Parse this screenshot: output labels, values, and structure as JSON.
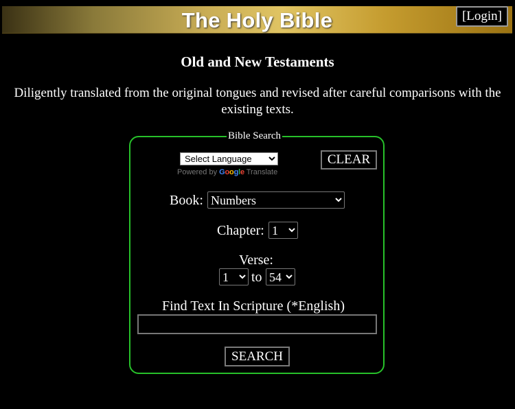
{
  "header": {
    "title": "The Holy Bible",
    "login_label": "[Login]"
  },
  "subtitle": "Old and New Testaments",
  "description": "Diligently translated from the original tongues and revised after careful comparisons with the existing texts.",
  "search": {
    "legend": "Bible Search",
    "language_select": "Select Language",
    "powered_by": "Powered by",
    "google": "Google",
    "translate": "Translate",
    "clear_label": "CLEAR",
    "book_label": "Book:",
    "book_value": "Numbers",
    "chapter_label": "Chapter:",
    "chapter_value": "1",
    "verse_label": "Verse:",
    "verse_from": "1",
    "verse_to_label": "to",
    "verse_to": "54",
    "find_label": "Find Text In Scripture (*English)",
    "search_text": "",
    "search_label": "SEARCH"
  },
  "colors": {
    "background": "#000000",
    "box_border": "#27c12a",
    "banner_gold": "#e0c463"
  }
}
